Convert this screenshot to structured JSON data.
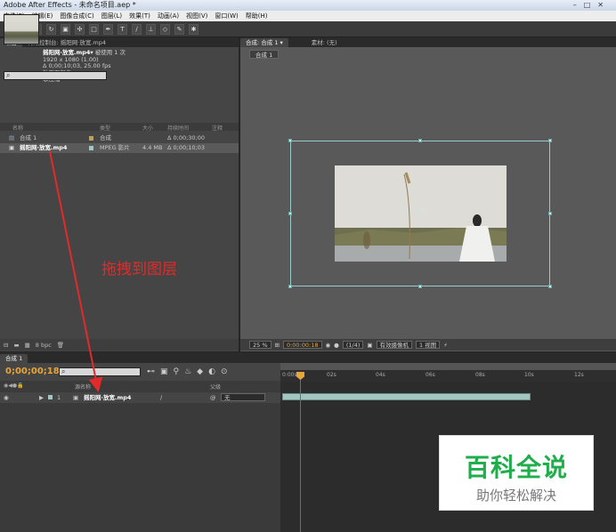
{
  "window": {
    "title": "Adobe After Effects - 未命名项目.aep *"
  },
  "menu": [
    "文件(F)",
    "编辑(E)",
    "图像合成(C)",
    "图层(L)",
    "效果(T)",
    "动画(A)",
    "视图(V)",
    "窗口(W)",
    "帮助(H)"
  ],
  "tools": [
    "selection",
    "hand",
    "zoom",
    "rotate",
    "camera",
    "pan",
    "mask",
    "pen",
    "text",
    "brush",
    "clone",
    "eraser",
    "roto",
    "puppet"
  ],
  "project": {
    "tabs": [
      "项目",
      "特效控制台: 摇阳网·放宽.mp4"
    ],
    "selected_name": "摇阳网·放宽.mp4▾",
    "used_count": "被使用 1 次",
    "info": [
      "1920 x 1080 (1.00)",
      "Δ 0;00;10;03, 25.00 fps",
      "数百万颜色",
      "非压缩"
    ],
    "columns": [
      "名称",
      "类型",
      "大小",
      "持续时间",
      "注释"
    ],
    "items": [
      {
        "name": "合成 1",
        "type": "合成",
        "size": "",
        "duration": "Δ 0;00;30;00",
        "color": "#b9a06a"
      },
      {
        "name": "摇阳网·放宽.mp4",
        "type": "MPEG 影片",
        "size": "4.4 MB",
        "duration": "Δ 0;00;10;03",
        "color": "#a3c7c0"
      }
    ],
    "bpc": "8 bpc"
  },
  "viewer": {
    "tabs": [
      "合成: 合成 1 ▾",
      "素材: (无)"
    ],
    "comp_tab": "合成 1",
    "zoom": "25 %",
    "timecode": "0:00:00:18",
    "resolution": "(1/4)",
    "camera": "有效摄像机",
    "views": "1 视图"
  },
  "timeline": {
    "tab": "合成 1",
    "timecode": "0;00;00;18",
    "columns": [
      "源名称",
      "父级"
    ],
    "layer": {
      "index": "1",
      "name": "摇阳网·放宽.mp4",
      "parent": "无"
    },
    "ruler": [
      "0:00s",
      "02s",
      "04s",
      "06s",
      "08s",
      "10s",
      "12s"
    ]
  },
  "annotation": "拖拽到图层",
  "watermark": {
    "title": "百科全说",
    "subtitle": "助你轻松解决"
  }
}
